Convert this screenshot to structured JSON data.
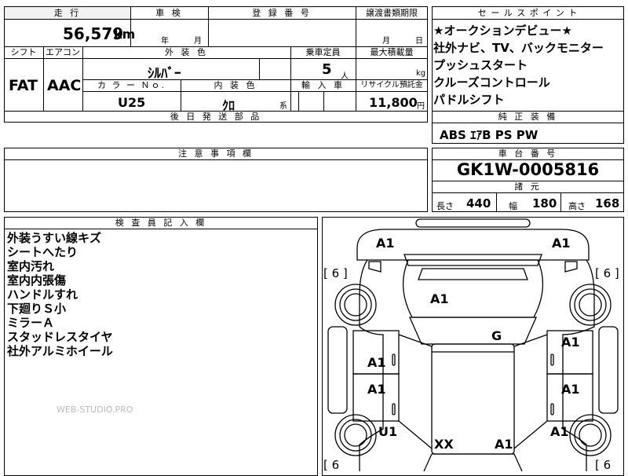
{
  "top": {
    "mileage_label": "走 行",
    "mileage_value": "56,579",
    "mileage_unit": "km",
    "inspection_label": "車 検",
    "inspection_year_unit": "年",
    "inspection_month_unit": "月",
    "registration_label": "登 録 番 号",
    "transfer_label": "譲渡書類期限",
    "transfer_month_unit": "月",
    "transfer_day_unit": "日"
  },
  "spec": {
    "shift_label": "シフト",
    "shift_value": "FAT",
    "aircon_label": "エアコン",
    "aircon_value": "AAC",
    "exterior_color_label": "外 装 色",
    "exterior_color_value": "ｼﾙﾊﾞｰ",
    "capacity_label": "乗車定員",
    "capacity_value": "5",
    "capacity_unit": "人",
    "max_load_label": "最大積載量",
    "max_load_unit": "kg",
    "color_no_label": "カ ラ ー Ｎｏ.",
    "color_no_value": "U25",
    "interior_color_label": "内 装 色",
    "interior_color_value": "ｸﾛ",
    "interior_suffix": "系",
    "import_label": "輸 入 車",
    "recycle_label": "リサイクル預託金",
    "recycle_value": "11,800",
    "recycle_unit": "円",
    "later_parts_label": "後 日 発 送 部 品"
  },
  "selling_points": {
    "title": "セ ー ル ス ポ イ ン ト",
    "items": [
      "★オークションデビュー★",
      "社外ナビ、TV、バックモニター",
      "プッシュスタート",
      "クルーズコントロール",
      "パドルシフト"
    ]
  },
  "equipment": {
    "title": "純 正 装 備",
    "value": "ABS ｴｱB PS PW"
  },
  "notes_header": "注 意 事 項 欄",
  "chassis": {
    "title": "車 台 番 号",
    "value": "GK1W-0005816"
  },
  "dimensions": {
    "title": "諸 元",
    "length_label": "長さ",
    "length_value": "440",
    "width_label": "幅",
    "width_value": "180",
    "height_label": "高さ",
    "height_value": "168"
  },
  "inspector": {
    "title": "検 査 員 記 入 欄",
    "notes": [
      "外装うすい線キズ",
      "シートへたり",
      "室内汚れ",
      "室内内張傷",
      "ハンドルすれ",
      "下廻りＳ小",
      "ミラーＡ",
      "スタッドレスタイヤ",
      "社外アルミホイール"
    ],
    "watermark": "WEB-STUDIO.PRO"
  },
  "diagram": {
    "tread_left_top": "[ 6 ]",
    "tread_right_top": "[ 6 ]",
    "tread_left_bottom": "[ 6",
    "tread_right_bottom": "[ 6",
    "marks": {
      "front_bumper_left": "A1",
      "front_bumper_right": "A1",
      "hood": "A1",
      "roof": "G",
      "front_door_left": "A1",
      "front_door_right": "A1",
      "rear_door_left": "A1",
      "rear_door_right": "A1",
      "rear_fender_left": "U1",
      "rear_fender_right": "A1",
      "tailgate": "XX",
      "rear_bumper": "A1"
    }
  }
}
